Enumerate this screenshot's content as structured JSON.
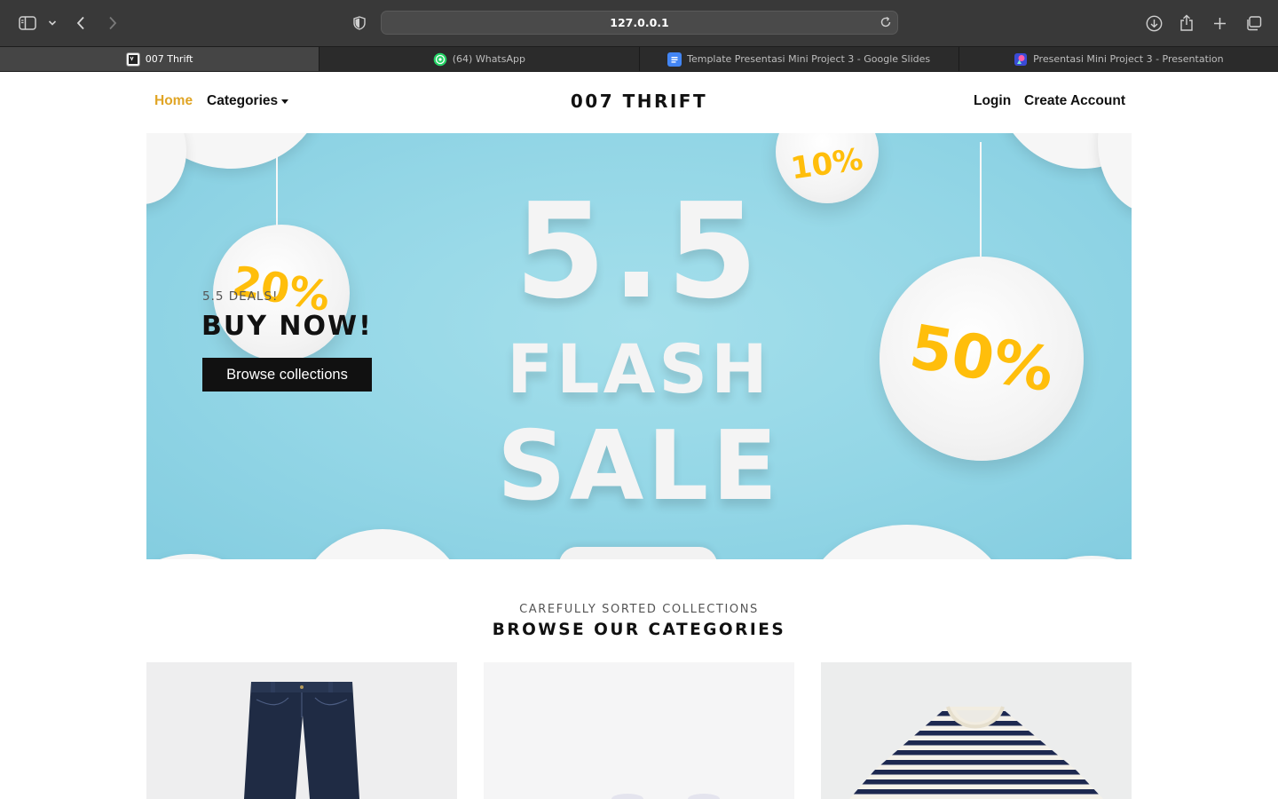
{
  "browser": {
    "url": "127.0.0.1",
    "tabs": [
      {
        "label": "007 Thrift",
        "active": true,
        "icon": "thrift-favicon"
      },
      {
        "label": "(64) WhatsApp",
        "active": false,
        "icon": "whatsapp-icon"
      },
      {
        "label": "Template Presentasi Mini Project 3 - Google Slides",
        "active": false,
        "icon": "google-slides-icon"
      },
      {
        "label": "Presentasi Mini Project 3 - Presentation",
        "active": false,
        "icon": "presentation-icon"
      }
    ]
  },
  "nav": {
    "home": "Home",
    "categories": "Categories",
    "brand": "007 THRIFT",
    "login": "Login",
    "create_account": "Create Account",
    "active_color": "#e0a526"
  },
  "hero": {
    "subtitle": "5.5 DEALS!",
    "title": "BUY NOW!",
    "button": "Browse collections",
    "banner": {
      "line1": "5.5",
      "line2": "FLASH",
      "line3": "SALE",
      "badge_left": "20%",
      "badge_top": "10%",
      "badge_right": "50%"
    },
    "accent_color": "#ffbe0b",
    "background_color": "#93d6e6"
  },
  "categories": {
    "subtitle": "CAREFULLY SORTED COLLECTIONS",
    "title": "BROWSE OUR CATEGORIES",
    "cards": [
      {
        "image": "denim-jeans"
      },
      {
        "image": "shoes-partial"
      },
      {
        "image": "striped-tshirt"
      }
    ]
  }
}
